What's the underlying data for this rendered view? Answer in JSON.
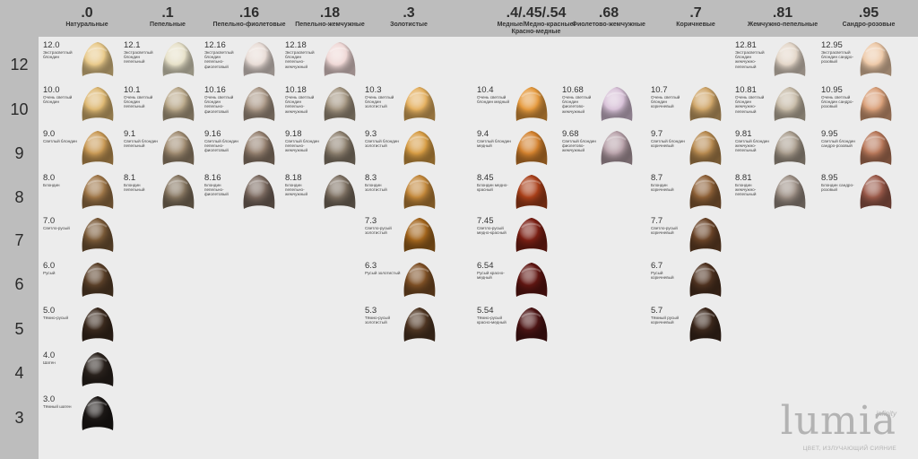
{
  "columns": [
    {
      "code": ".0",
      "name": "Натуральные"
    },
    {
      "code": ".1",
      "name": "Пепельные"
    },
    {
      "code": ".16",
      "name": "Пепельно-фиолетовые"
    },
    {
      "code": ".18",
      "name": "Пепельно-жемчужные"
    },
    {
      "code": ".3",
      "name": "Золотистые"
    },
    {
      "code": ".4/.45/.54",
      "name": "Медные/Медно-красные/\nКрасно-медные"
    },
    {
      "code": ".68",
      "name": "Фиолетово-жемчужные"
    },
    {
      "code": ".7",
      "name": "Коричневые"
    },
    {
      "code": ".81",
      "name": "Жемчужно-пепельные"
    },
    {
      "code": ".95",
      "name": "Сандро-розовые"
    }
  ],
  "levels": [
    "12",
    "10",
    "9",
    "8",
    "7",
    "6",
    "5",
    "4",
    "3"
  ],
  "shades": [
    {
      "col": 0,
      "row": 0,
      "code": "12.0",
      "desc": "Экстрасветлый блондин",
      "color": "#e8c98a"
    },
    {
      "col": 0,
      "row": 1,
      "code": "10.0",
      "desc": "Очень светлый блондин",
      "color": "#ddb873"
    },
    {
      "col": 0,
      "row": 2,
      "code": "9.0",
      "desc": "Светлый блондин",
      "color": "#c99a56"
    },
    {
      "col": 0,
      "row": 3,
      "code": "8.0",
      "desc": "Блондин",
      "color": "#9e7648"
    },
    {
      "col": 0,
      "row": 4,
      "code": "7.0",
      "desc": "Светло-русый",
      "color": "#7a5a38"
    },
    {
      "col": 0,
      "row": 5,
      "code": "6.0",
      "desc": "Русый",
      "color": "#5a4029"
    },
    {
      "col": 0,
      "row": 6,
      "code": "5.0",
      "desc": "Тёмно-русый",
      "color": "#3b2a1e"
    },
    {
      "col": 0,
      "row": 7,
      "code": "4.0",
      "desc": "Шатен",
      "color": "#2a221d"
    },
    {
      "col": 0,
      "row": 8,
      "code": "3.0",
      "desc": "Тёмный шатен",
      "color": "#1c1816"
    },
    {
      "col": 1,
      "row": 0,
      "code": "12.1",
      "desc": "Экстрасветлый блондин пепельный",
      "color": "#e6e0c8"
    },
    {
      "col": 1,
      "row": 1,
      "code": "10.1",
      "desc": "Очень светлый блондин пепельный",
      "color": "#b9a88a"
    },
    {
      "col": 1,
      "row": 2,
      "code": "9.1",
      "desc": "Светлый блондин пепельный",
      "color": "#a08c72"
    },
    {
      "col": 1,
      "row": 3,
      "code": "8.1",
      "desc": "Блондин пепельный",
      "color": "#857560"
    },
    {
      "col": 2,
      "row": 0,
      "code": "12.16",
      "desc": "Экстрасветлый блондин пепельно-фиолетовый",
      "color": "#e8dcd6"
    },
    {
      "col": 2,
      "row": 1,
      "code": "10.16",
      "desc": "Очень светлый блондин пепельно-фиолетовый",
      "color": "#ab9988"
    },
    {
      "col": 2,
      "row": 2,
      "code": "9.16",
      "desc": "Светлый блондин пепельно-фиолетовый",
      "color": "#94806f"
    },
    {
      "col": 2,
      "row": 3,
      "code": "8.16",
      "desc": "Блондин пепельно-фиолетовый",
      "color": "#7b6a60"
    },
    {
      "col": 3,
      "row": 0,
      "code": "12.18",
      "desc": "Экстрасветлый блондин пепельно-жемчужный",
      "color": "#efd8d6"
    },
    {
      "col": 3,
      "row": 1,
      "code": "10.18",
      "desc": "Очень светлый блондин пепельно-жемчужный",
      "color": "#a49682"
    },
    {
      "col": 3,
      "row": 2,
      "code": "9.18",
      "desc": "Светлый блондин пепельно-жемчужный",
      "color": "#8e8170"
    },
    {
      "col": 3,
      "row": 3,
      "code": "8.18",
      "desc": "Блондин пепельно-жемчужный",
      "color": "#7d7062"
    },
    {
      "col": 4,
      "row": 1,
      "code": "10.3",
      "desc": "Очень светлый блондин золотистый",
      "color": "#e4b060"
    },
    {
      "col": 4,
      "row": 2,
      "code": "9.3",
      "desc": "Светлый блондин золотистый",
      "color": "#d69c44"
    },
    {
      "col": 4,
      "row": 3,
      "code": "8.3",
      "desc": "Блондин золотистый",
      "color": "#c2873a"
    },
    {
      "col": 4,
      "row": 4,
      "code": "7.3",
      "desc": "Светло-русый золотистый",
      "color": "#a3661e"
    },
    {
      "col": 4,
      "row": 5,
      "code": "6.3",
      "desc": "Русый золотистый",
      "color": "#7d4f25"
    },
    {
      "col": 4,
      "row": 6,
      "code": "5.3",
      "desc": "Тёмно-русый золотистый",
      "color": "#4f3623"
    },
    {
      "col": 5,
      "row": 1,
      "code": "10.4",
      "desc": "Очень светлый блондин медный",
      "color": "#e59a3e"
    },
    {
      "col": 5,
      "row": 2,
      "code": "9.4",
      "desc": "Светлый блондин медный",
      "color": "#d2812e"
    },
    {
      "col": 5,
      "row": 3,
      "code": "8.45",
      "desc": "Блондин медно-красный",
      "color": "#a9401a"
    },
    {
      "col": 5,
      "row": 4,
      "code": "7.45",
      "desc": "Светло-русый медно-красный",
      "color": "#7a1f14"
    },
    {
      "col": 5,
      "row": 5,
      "code": "6.54",
      "desc": "Русый красно-медный",
      "color": "#5f1612"
    },
    {
      "col": 5,
      "row": 6,
      "code": "5.54",
      "desc": "Тёмно-русый красно-медный",
      "color": "#4b1414"
    },
    {
      "col": 6,
      "row": 1,
      "code": "10.68",
      "desc": "Очень светлый блондин фиолетово-жемчужный",
      "color": "#d8c2d8"
    },
    {
      "col": 6,
      "row": 2,
      "code": "9.68",
      "desc": "Светлый блондин фиолетово-жемчужный",
      "color": "#b8a2aa"
    },
    {
      "col": 7,
      "row": 1,
      "code": "10.7",
      "desc": "Очень светлый блондин коричневый",
      "color": "#cfa66a"
    },
    {
      "col": 7,
      "row": 2,
      "code": "9.7",
      "desc": "Светлый блондин коричневый",
      "color": "#b78a50"
    },
    {
      "col": 7,
      "row": 3,
      "code": "8.7",
      "desc": "Блондин коричневый",
      "color": "#8d6037"
    },
    {
      "col": 7,
      "row": 4,
      "code": "7.7",
      "desc": "Светло-русый коричневый",
      "color": "#6a4428"
    },
    {
      "col": 7,
      "row": 5,
      "code": "6.7",
      "desc": "Русый коричневый",
      "color": "#4e3220"
    },
    {
      "col": 7,
      "row": 6,
      "code": "5.7",
      "desc": "Тёмный русый коричневый",
      "color": "#3c281c"
    },
    {
      "col": 8,
      "row": 0,
      "code": "12.81",
      "desc": "Экстрасветлый блондин жемчужно-пепельный",
      "color": "#e3d6c8"
    },
    {
      "col": 8,
      "row": 1,
      "code": "10.81",
      "desc": "Очень светлый блондин жемчужно-пепельный",
      "color": "#c7bba8"
    },
    {
      "col": 8,
      "row": 2,
      "code": "9.81",
      "desc": "Светлый блондин жемчужно-пепельный",
      "color": "#a99d8e"
    },
    {
      "col": 8,
      "row": 3,
      "code": "8.81",
      "desc": "Блондин жемчужно-пепельный",
      "color": "#9c8f85"
    },
    {
      "col": 9,
      "row": 0,
      "code": "12.95",
      "desc": "Экстрасветлый блондин сандро-розовый",
      "color": "#edc9a8"
    },
    {
      "col": 9,
      "row": 1,
      "code": "10.95",
      "desc": "Очень светлый блондин сандро-розовый",
      "color": "#d9a07a"
    },
    {
      "col": 9,
      "row": 2,
      "code": "9.95",
      "desc": "Светлый блондин сандро-розовый",
      "color": "#b8785a"
    },
    {
      "col": 9,
      "row": 3,
      "code": "8.95",
      "desc": "Блондин сандро-розовый",
      "color": "#9a5a4a"
    }
  ],
  "brand": {
    "sub": "infinity",
    "name": "lumia",
    "tagline": "ЦВЕТ, ИЗЛУЧАЮЩИЙ СИЯНИЕ"
  }
}
